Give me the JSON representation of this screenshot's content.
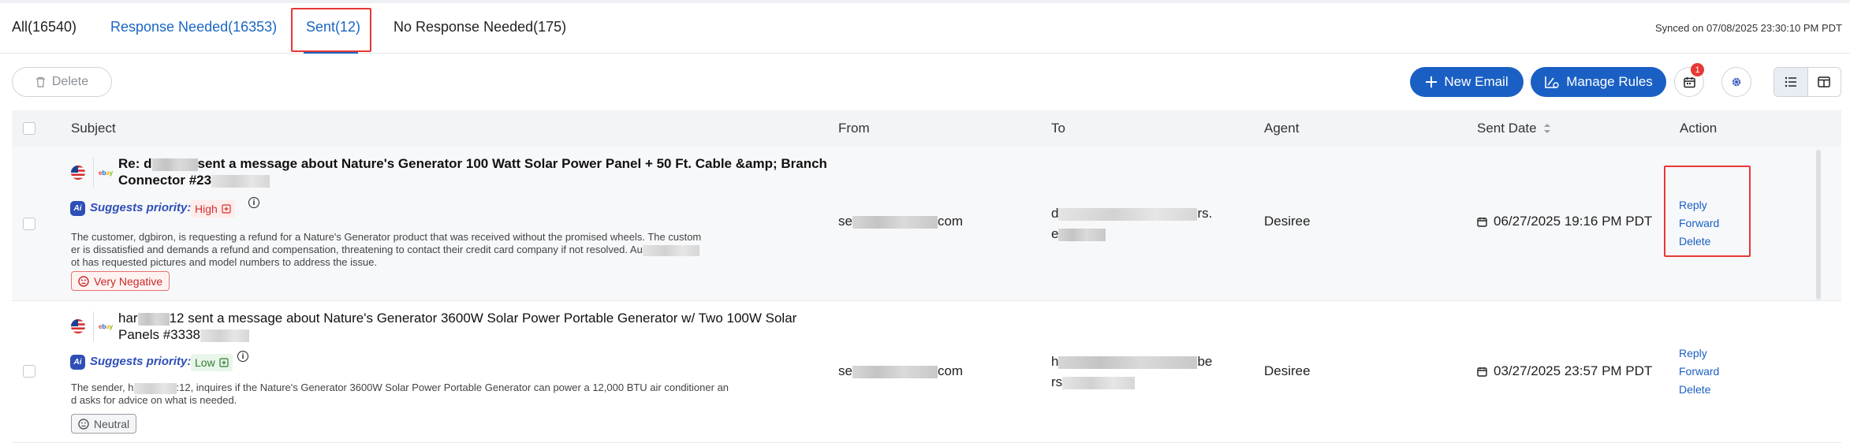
{
  "tabs": {
    "all": "All(16540)",
    "response_needed": "Response Needed(16353)",
    "sent": "Sent(12)",
    "no_response": "No Response Needed(175)"
  },
  "synced": "Synced on 07/08/2025 23:30:10 PM PDT",
  "toolbar": {
    "delete_label": "Delete",
    "new_email_label": "New Email",
    "manage_rules_label": "Manage Rules",
    "calendar_badge": "1"
  },
  "columns": {
    "subject": "Subject",
    "from": "From",
    "to": "To",
    "agent": "Agent",
    "sent_date": "Sent Date",
    "action": "Action"
  },
  "rows": [
    {
      "subject_line1_prefix": "Re: d",
      "subject_line1_suffix": "sent a message about Nature's Generator 100 Watt Solar Power Panel + 50 Ft. Cable &amp; Branch",
      "subject_line2": "Connector #23",
      "suggests_label": "Suggests priority:",
      "priority": "High",
      "summary_line1": "The customer, dgbiron, is requesting a refund for a Nature's Generator product that was received without the promised wheels. The custom",
      "summary_line2": "er is dissatisfied and demands a refund and compensation, threatening to contact their credit card company if not resolved. Au",
      "summary_line3": "ot has requested pictures and model numbers to address the issue.",
      "sentiment": "Very Negative",
      "from_prefix": "se",
      "from_suffix": "com",
      "to_line1_prefix": "d",
      "to_line1_suffix": "rs.",
      "to_line2_prefix": "e",
      "agent": "Desiree",
      "sent_date": "06/27/2025 19:16 PM PDT",
      "actions": [
        "Reply",
        "Forward",
        "Delete"
      ]
    },
    {
      "subject_line1_prefix": "har",
      "subject_line1_suffix": "12 sent a message about Nature's Generator 3600W Solar Power Portable Generator w/ Two 100W Solar",
      "subject_line2": "Panels #3338",
      "suggests_label": "Suggests priority:",
      "priority": "Low",
      "summary_line1_prefix": "The sender, h",
      "summary_line1_suffix": ":12, inquires if the Nature's Generator 3600W Solar Power Portable Generator can power a 12,000 BTU air conditioner an",
      "summary_line2": "d asks for advice on what is needed.",
      "sentiment": "Neutral",
      "from_prefix": "se",
      "from_suffix": "com",
      "to_line1_prefix": "h",
      "to_line1_suffix": "be",
      "to_line2_prefix": "rs",
      "agent": "Desiree",
      "sent_date": "03/27/2025 23:57 PM PDT",
      "actions": [
        "Reply",
        "Forward",
        "Delete"
      ]
    }
  ],
  "icons": {
    "delete": "trash-icon",
    "new_email": "plus-icon",
    "manage_rules": "rules-icon",
    "calendar": "calendar-icon",
    "settings": "gear-icon",
    "list_view": "list-view-icon",
    "split_view": "split-view-icon",
    "sort": "sort-icon",
    "flag": "us-flag-icon",
    "marketplace": "ebay-logo",
    "ai": "ai-icon",
    "info": "info-icon",
    "clock": "clock-icon"
  },
  "colors": {
    "accent": "#1a5fc4",
    "highlight_box": "#e53935",
    "priority_high": "#d32f2f",
    "priority_low": "#2e7d32"
  }
}
